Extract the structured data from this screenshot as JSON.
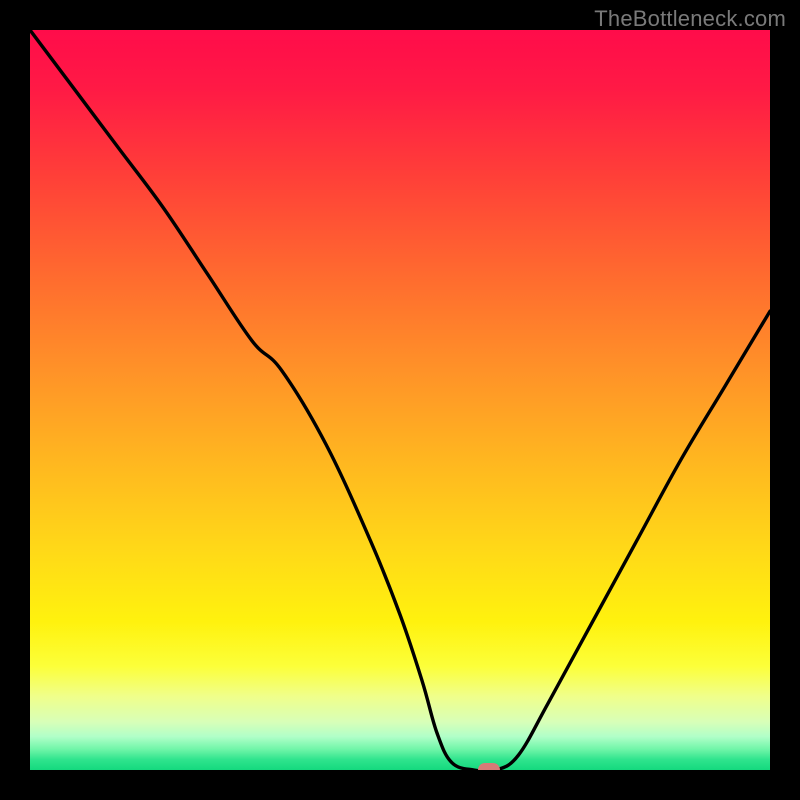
{
  "watermark": "TheBottleneck.com",
  "chart_data": {
    "type": "line",
    "title": "",
    "xlabel": "",
    "ylabel": "",
    "xlim": [
      0,
      100
    ],
    "ylim": [
      0,
      100
    ],
    "x": [
      0,
      6,
      12,
      18,
      24,
      30,
      34,
      40,
      46,
      50,
      53,
      55,
      57,
      60,
      63,
      66,
      70,
      76,
      82,
      88,
      94,
      100
    ],
    "values": [
      100,
      92,
      84,
      76,
      67,
      58,
      54,
      44,
      31,
      21,
      12,
      5,
      1,
      0,
      0,
      2,
      9,
      20,
      31,
      42,
      52,
      62
    ],
    "gradient_stops": [
      {
        "pos": 0.0,
        "color": "#ff0c4a"
      },
      {
        "pos": 0.08,
        "color": "#ff1a45"
      },
      {
        "pos": 0.2,
        "color": "#ff4038"
      },
      {
        "pos": 0.33,
        "color": "#ff6a2f"
      },
      {
        "pos": 0.46,
        "color": "#ff9228"
      },
      {
        "pos": 0.58,
        "color": "#ffb620"
      },
      {
        "pos": 0.7,
        "color": "#ffd818"
      },
      {
        "pos": 0.8,
        "color": "#fff20e"
      },
      {
        "pos": 0.86,
        "color": "#fcff3a"
      },
      {
        "pos": 0.9,
        "color": "#f0ff8a"
      },
      {
        "pos": 0.935,
        "color": "#d8ffb8"
      },
      {
        "pos": 0.955,
        "color": "#b0ffc8"
      },
      {
        "pos": 0.972,
        "color": "#70f5a8"
      },
      {
        "pos": 0.986,
        "color": "#2fe48d"
      },
      {
        "pos": 1.0,
        "color": "#14d97e"
      }
    ],
    "marker": {
      "x": 62,
      "y": 0,
      "color": "#d87a77"
    }
  }
}
